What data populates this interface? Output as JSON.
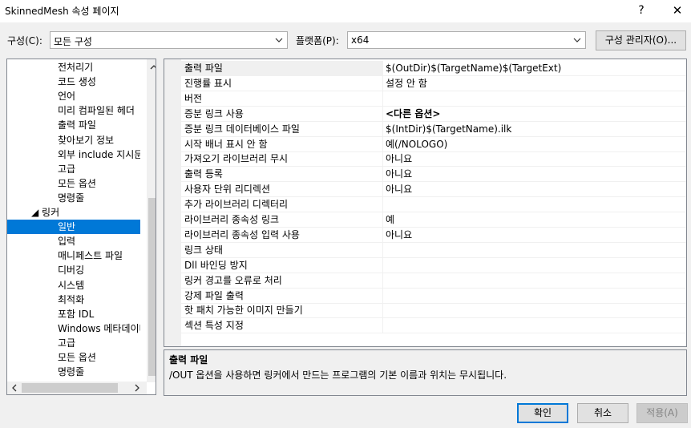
{
  "window": {
    "title": "SkinnedMesh 속성 페이지",
    "help": "?",
    "close": "✕"
  },
  "toolbar": {
    "config_label": "구성(C):",
    "config_value": "모든 구성",
    "platform_label": "플랫폼(P):",
    "platform_value": "x64",
    "config_manager": "구성 관리자(O)..."
  },
  "tree": {
    "items": [
      {
        "label": "전처리기",
        "indent": 2,
        "selected": false
      },
      {
        "label": "코드 생성",
        "indent": 2,
        "selected": false
      },
      {
        "label": "언어",
        "indent": 2,
        "selected": false
      },
      {
        "label": "미리 컴파일된 헤더",
        "indent": 2,
        "selected": false
      },
      {
        "label": "출력 파일",
        "indent": 2,
        "selected": false
      },
      {
        "label": "찾아보기 정보",
        "indent": 2,
        "selected": false
      },
      {
        "label": "외부 include 지시문",
        "indent": 2,
        "selected": false
      },
      {
        "label": "고급",
        "indent": 2,
        "selected": false
      },
      {
        "label": "모든 옵션",
        "indent": 2,
        "selected": false
      },
      {
        "label": "명령줄",
        "indent": 2,
        "selected": false
      },
      {
        "label": "◢  링커",
        "indent": 1,
        "selected": false
      },
      {
        "label": "일반",
        "indent": 2,
        "selected": true
      },
      {
        "label": "입력",
        "indent": 2,
        "selected": false
      },
      {
        "label": "매니페스트 파일",
        "indent": 2,
        "selected": false
      },
      {
        "label": "디버깅",
        "indent": 2,
        "selected": false
      },
      {
        "label": "시스템",
        "indent": 2,
        "selected": false
      },
      {
        "label": "최적화",
        "indent": 2,
        "selected": false
      },
      {
        "label": "포함 IDL",
        "indent": 2,
        "selected": false
      },
      {
        "label": "Windows 메타데이터",
        "indent": 2,
        "selected": false
      },
      {
        "label": "고급",
        "indent": 2,
        "selected": false
      },
      {
        "label": "모든 옵션",
        "indent": 2,
        "selected": false
      },
      {
        "label": "명령줄",
        "indent": 2,
        "selected": false
      }
    ]
  },
  "properties": [
    {
      "name": "출력 파일",
      "value": "$(OutDir)$(TargetName)$(TargetExt)",
      "bold": false,
      "selected": true
    },
    {
      "name": "진행률 표시",
      "value": "설정 안 함",
      "bold": false,
      "selected": false
    },
    {
      "name": "버전",
      "value": "",
      "bold": false,
      "selected": false
    },
    {
      "name": "증분 링크 사용",
      "value": "<다른 옵션>",
      "bold": true,
      "selected": false
    },
    {
      "name": "증분 링크 데이터베이스 파일",
      "value": "$(IntDir)$(TargetName).ilk",
      "bold": false,
      "selected": false
    },
    {
      "name": "시작 배너 표시 안 함",
      "value": "예(/NOLOGO)",
      "bold": false,
      "selected": false
    },
    {
      "name": "가져오기 라이브러리 무시",
      "value": "아니요",
      "bold": false,
      "selected": false
    },
    {
      "name": "출력 등록",
      "value": "아니요",
      "bold": false,
      "selected": false
    },
    {
      "name": "사용자 단위 리디렉션",
      "value": "아니요",
      "bold": false,
      "selected": false
    },
    {
      "name": "추가 라이브러리 디렉터리",
      "value": "",
      "bold": false,
      "selected": false
    },
    {
      "name": "라이브러리 종속성 링크",
      "value": "예",
      "bold": false,
      "selected": false
    },
    {
      "name": "라이브러리 종속성 입력 사용",
      "value": "아니요",
      "bold": false,
      "selected": false
    },
    {
      "name": "링크 상태",
      "value": "",
      "bold": false,
      "selected": false
    },
    {
      "name": "Dll 바인딩 방지",
      "value": "",
      "bold": false,
      "selected": false
    },
    {
      "name": "링커 경고를 오류로 처리",
      "value": "",
      "bold": false,
      "selected": false
    },
    {
      "name": "강제 파일 출력",
      "value": "",
      "bold": false,
      "selected": false
    },
    {
      "name": "핫 패치 가능한 이미지 만들기",
      "value": "",
      "bold": false,
      "selected": false
    },
    {
      "name": "섹션 특성 지정",
      "value": "",
      "bold": false,
      "selected": false
    }
  ],
  "description": {
    "title": "출력 파일",
    "text": "/OUT 옵션을 사용하면 링커에서 만드는 프로그램의 기본 이름과 위치는 무시됩니다."
  },
  "buttons": {
    "ok": "확인",
    "cancel": "취소",
    "apply": "적용(A)"
  },
  "colors": {
    "selection": "#0078d7",
    "window_bg": "#f0f0f0"
  }
}
